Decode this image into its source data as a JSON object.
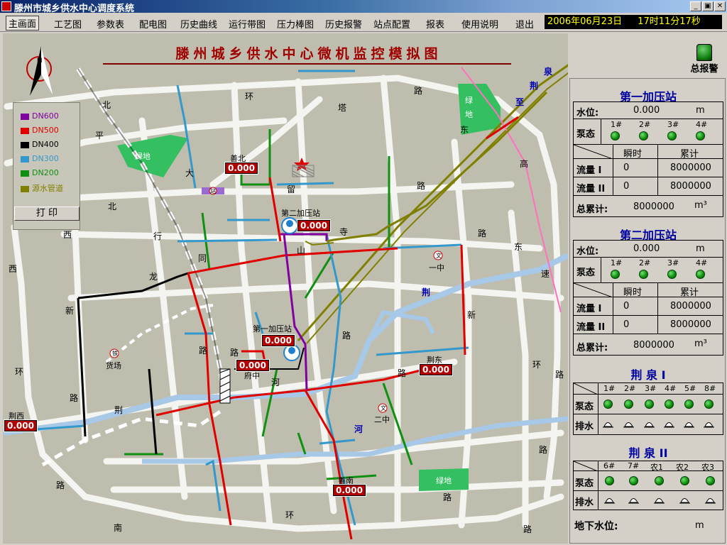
{
  "window": {
    "title": "滕州市城乡供水中心调度系统",
    "btn_min": "_",
    "btn_max": "▣",
    "btn_close": "✕"
  },
  "menu": [
    "主画面",
    "工艺图",
    "参数表",
    "配电图",
    "历史曲线",
    "运行带图",
    "压力棒图",
    "历史报警",
    "站点配置",
    "报表",
    "使用说明",
    "退出"
  ],
  "datetime": {
    "date": "2006年06月23日",
    "time": "17时11分17秒"
  },
  "map": {
    "title": "滕州城乡供水中心微机监控模拟图",
    "legend": [
      {
        "label": "DN600",
        "color": "#8000a0"
      },
      {
        "label": "DN500",
        "color": "#e00000"
      },
      {
        "label": "DN400",
        "color": "#000000"
      },
      {
        "label": "DN300",
        "color": "#3399cc"
      },
      {
        "label": "DN200",
        "color": "#109010"
      },
      {
        "label": "源水管道",
        "color": "#808000"
      }
    ],
    "print_label": "打 印",
    "stations": [
      {
        "name": "善北",
        "value": "0.000"
      },
      {
        "name": "第二加压站",
        "value": "0.000"
      },
      {
        "name": "第一加压站",
        "value": "0.000"
      },
      {
        "name": "府中",
        "value": "0.000"
      },
      {
        "name": "荆东",
        "value": "0.000"
      },
      {
        "name": "荆西",
        "value": "0.000"
      },
      {
        "name": "善南",
        "value": "0.000"
      }
    ],
    "road_chars": [
      "北",
      "环",
      "路",
      "塔",
      "平",
      "大",
      "留",
      "路",
      "北",
      "寺",
      "路",
      "西",
      "行",
      "同",
      "山",
      "东",
      "西",
      "龙",
      "新",
      "路",
      "路",
      "新",
      "路",
      "府中",
      "河",
      "荆",
      "路",
      "环",
      "路",
      "路",
      "路",
      "环",
      "南",
      "新",
      "高",
      "速",
      "东",
      "环",
      "路",
      "路"
    ],
    "places": {
      "green1": "绿地",
      "green2": "绿地",
      "green3": "绿地",
      "yizhong": "一中",
      "erzhong": "二中",
      "huochang": "货场",
      "rail_near": "站",
      "school1": "文",
      "school2": "文",
      "rail_icon": "铁"
    },
    "blue_labels": {
      "quan": "泉",
      "jing": "荆",
      "zhi": "至",
      "jing2": "荆",
      "he": "河"
    },
    "compass": "N"
  },
  "alarm": {
    "label": "总报警"
  },
  "panel": {
    "s1": {
      "title": "第一加压站",
      "water_level_label": "水位:",
      "water_level": "0.000",
      "unit_m": "m",
      "pump_label": "泵态",
      "pumps": [
        "1#",
        "2#",
        "3#",
        "4#"
      ],
      "col_inst": "瞬时",
      "col_total": "累计",
      "flow1_label": "流量 I",
      "flow1_inst": "0",
      "flow1_total": "8000000",
      "flow2_label": "流量 II",
      "flow2_inst": "0",
      "flow2_total": "8000000",
      "total_label": "总累计:",
      "total": "8000000",
      "total_unit": "m³"
    },
    "s2": {
      "title": "第二加压站",
      "water_level_label": "水位:",
      "water_level": "0.000",
      "unit_m": "m",
      "pump_label": "泵态",
      "pumps": [
        "1#",
        "2#",
        "3#",
        "4#"
      ],
      "col_inst": "瞬时",
      "col_total": "累计",
      "flow1_label": "流量 I",
      "flow1_inst": "0",
      "flow1_total": "8000000",
      "flow2_label": "流量 II",
      "flow2_inst": "0",
      "flow2_total": "8000000",
      "total_label": "总累计:",
      "total": "8000000",
      "total_unit": "m³"
    },
    "q1": {
      "title": "荆 泉 I",
      "pumps": [
        "1#",
        "2#",
        "3#",
        "4#",
        "5#",
        "8#"
      ],
      "pump_label": "泵态",
      "drain_label": "排水"
    },
    "q2": {
      "title": "荆 泉 II",
      "pumps": [
        "6#",
        "7#",
        "农1",
        "农2",
        "农3"
      ],
      "pump_label": "泵态",
      "drain_label": "排水"
    },
    "ground": {
      "label": "地下水位:",
      "unit": "m"
    }
  }
}
